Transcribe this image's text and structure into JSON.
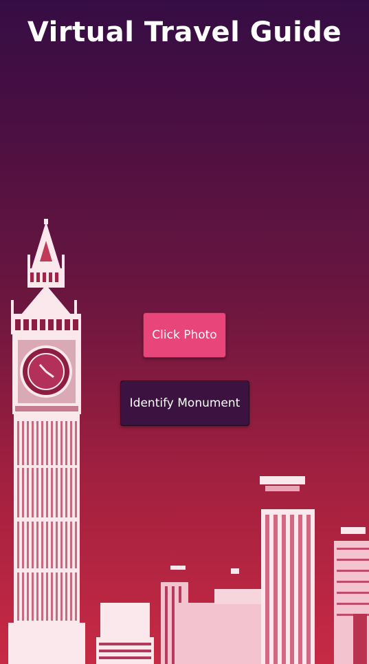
{
  "app": {
    "title": "Virtual Travel Guide"
  },
  "buttons": {
    "click_photo_label": "Click Photo",
    "identify_monument_label": "Identify Monument"
  },
  "colors": {
    "background_top": "#350d44",
    "background_bottom": "#c72a44",
    "click_photo_button": "#e8457a",
    "identify_button": "#3c1240",
    "text": "#ffffff"
  },
  "illustration": {
    "icon": "big-ben-london-skyline"
  }
}
